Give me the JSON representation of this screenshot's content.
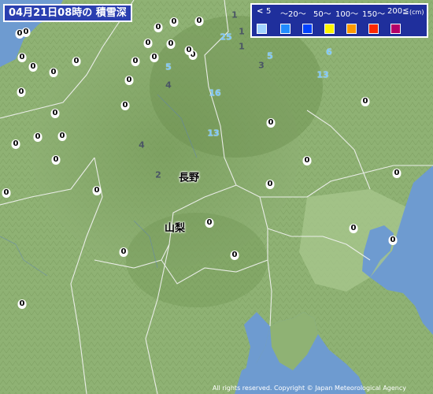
{
  "title": "04月21日08時の 積雪深",
  "legend": {
    "arrow": "<",
    "labels": [
      "5",
      "～20～",
      "50～",
      "100～",
      "150～",
      "200≦",
      "(cm)"
    ],
    "colors": [
      "#a0d2ff",
      "#218cff",
      "#0041ff",
      "#fff500",
      "#ff9900",
      "#ff2800",
      "#b40068"
    ]
  },
  "places": [
    {
      "name": "長野"
    },
    {
      "name": "山梨"
    }
  ],
  "readings": [
    {
      "v": "0",
      "k": "zero"
    },
    {
      "v": "0",
      "k": "zero"
    },
    {
      "v": "0",
      "k": "zero"
    },
    {
      "v": "0",
      "k": "zero"
    },
    {
      "v": "0",
      "k": "zero"
    },
    {
      "v": "0",
      "k": "zero"
    },
    {
      "v": "0",
      "k": "zero"
    },
    {
      "v": "0",
      "k": "zero"
    },
    {
      "v": "0",
      "k": "zero"
    },
    {
      "v": "0",
      "k": "zero"
    },
    {
      "v": "0",
      "k": "zero"
    },
    {
      "v": "0",
      "k": "zero"
    },
    {
      "v": "0",
      "k": "zero"
    },
    {
      "v": "0",
      "k": "zero"
    },
    {
      "v": "0",
      "k": "zero"
    },
    {
      "v": "0",
      "k": "zero"
    },
    {
      "v": "0",
      "k": "zero"
    },
    {
      "v": "0",
      "k": "zero"
    },
    {
      "v": "0",
      "k": "zero"
    },
    {
      "v": "0",
      "k": "zero"
    },
    {
      "v": "0",
      "k": "zero"
    },
    {
      "v": "0",
      "k": "zero"
    },
    {
      "v": "0",
      "k": "zero"
    },
    {
      "v": "0",
      "k": "zero"
    },
    {
      "v": "0",
      "k": "zero"
    },
    {
      "v": "0",
      "k": "zero"
    },
    {
      "v": "0",
      "k": "zero"
    },
    {
      "v": "0",
      "k": "zero"
    },
    {
      "v": "0",
      "k": "zero"
    },
    {
      "v": "0",
      "k": "zero"
    },
    {
      "v": "0",
      "k": "zero"
    },
    {
      "v": "0",
      "k": "zero"
    },
    {
      "v": "0",
      "k": "zero"
    },
    {
      "v": "0",
      "k": "zero"
    },
    {
      "v": "0",
      "k": "zero"
    },
    {
      "v": "0",
      "k": "zero"
    },
    {
      "v": "25",
      "k": "snow"
    },
    {
      "v": "5",
      "k": "snow"
    },
    {
      "v": "5",
      "k": "snow"
    },
    {
      "v": "6",
      "k": "snow"
    },
    {
      "v": "13",
      "k": "snow"
    },
    {
      "v": "16",
      "k": "snow"
    },
    {
      "v": "13",
      "k": "snow"
    },
    {
      "v": "1",
      "k": "grey"
    },
    {
      "v": "1",
      "k": "grey"
    },
    {
      "v": "1",
      "k": "grey"
    },
    {
      "v": "3",
      "k": "grey"
    },
    {
      "v": "4",
      "k": "grey"
    },
    {
      "v": "4",
      "k": "grey"
    },
    {
      "v": "2",
      "k": "grey"
    }
  ],
  "copyright": "All rights reserved. Copyright © Japan Meteorological Agency"
}
